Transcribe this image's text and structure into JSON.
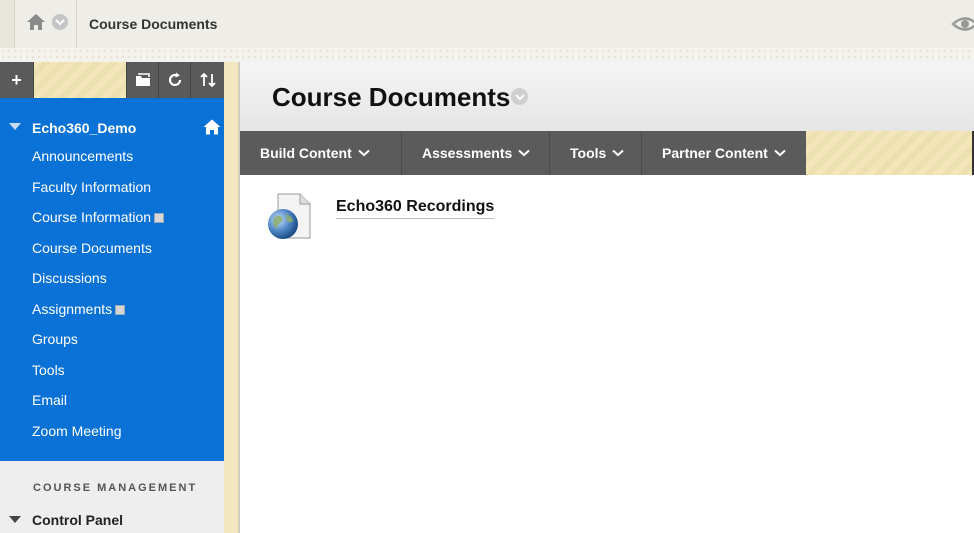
{
  "breadcrumb": {
    "title": "Course Documents"
  },
  "course": {
    "name": "Echo360_Demo"
  },
  "nav": {
    "items": [
      {
        "label": "Announcements",
        "badge": false
      },
      {
        "label": "Faculty Information",
        "badge": false
      },
      {
        "label": "Course Information",
        "badge": true
      },
      {
        "label": "Course Documents",
        "badge": false
      },
      {
        "label": "Discussions",
        "badge": false
      },
      {
        "label": "Assignments",
        "badge": true
      },
      {
        "label": "Groups",
        "badge": false
      },
      {
        "label": "Tools",
        "badge": false
      },
      {
        "label": "Email",
        "badge": false
      },
      {
        "label": "Zoom Meeting",
        "badge": false
      }
    ]
  },
  "sidebar": {
    "toolbar": {
      "add": "+"
    },
    "course_management_label": "COURSE MANAGEMENT",
    "control_panel_label": "Control Panel"
  },
  "page": {
    "title": "Course Documents"
  },
  "actionbar": {
    "items": [
      {
        "label": "Build Content"
      },
      {
        "label": "Assessments"
      },
      {
        "label": "Tools"
      },
      {
        "label": "Partner Content"
      }
    ]
  },
  "content": {
    "items": [
      {
        "title": "Echo360 Recordings",
        "icon": "globe-web-link-icon"
      }
    ]
  },
  "colors": {
    "nav_blue": "#0a72d6",
    "actionbar_gray": "#5b5b5b",
    "stripe_yellow": "#f4e6b8"
  }
}
